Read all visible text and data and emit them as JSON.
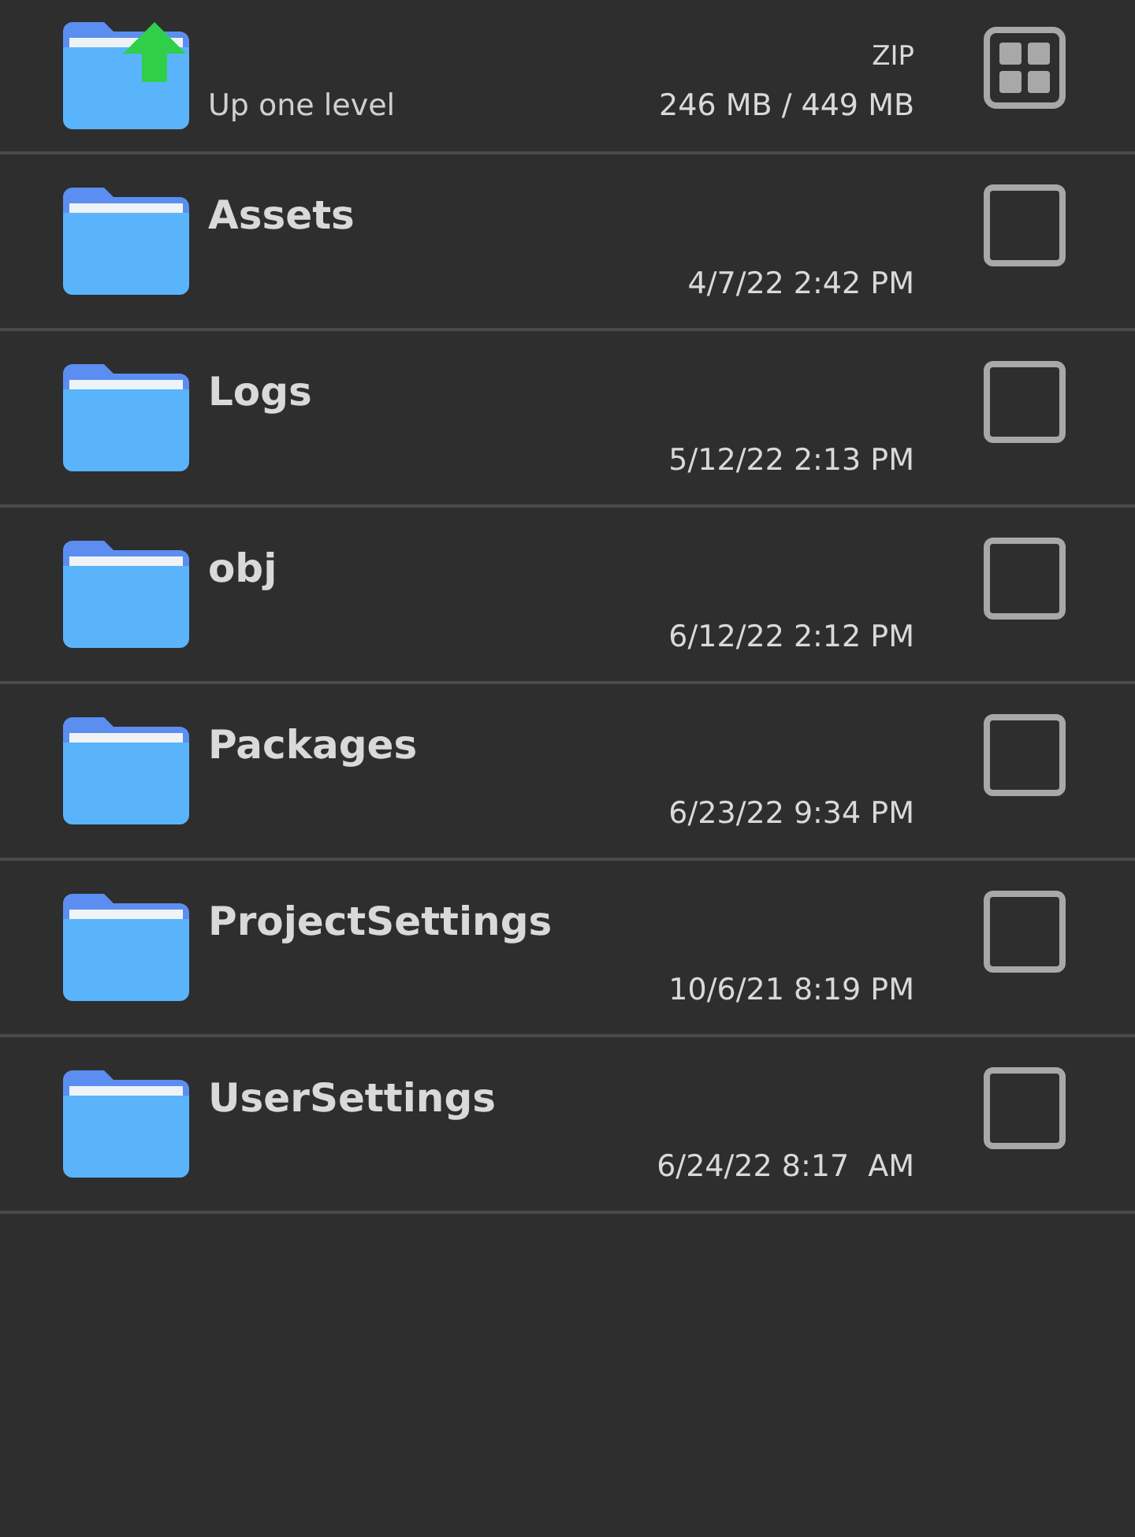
{
  "parent": {
    "label": "Up one level",
    "type": "ZIP",
    "storage": "246 MB / 449 MB"
  },
  "items": [
    {
      "name": "Assets",
      "date": "4/7/22 2:42 PM",
      "checked": false
    },
    {
      "name": "Logs",
      "date": "5/12/22 2:13 PM",
      "checked": false
    },
    {
      "name": "obj",
      "date": "6/12/22 2:12 PM",
      "checked": false
    },
    {
      "name": "Packages",
      "date": "6/23/22 9:34 PM",
      "checked": false
    },
    {
      "name": "ProjectSettings",
      "date": "10/6/21 8:19 PM",
      "checked": false
    },
    {
      "name": "UserSettings",
      "date": "6/24/22 8:17  AM",
      "checked": false
    }
  ]
}
